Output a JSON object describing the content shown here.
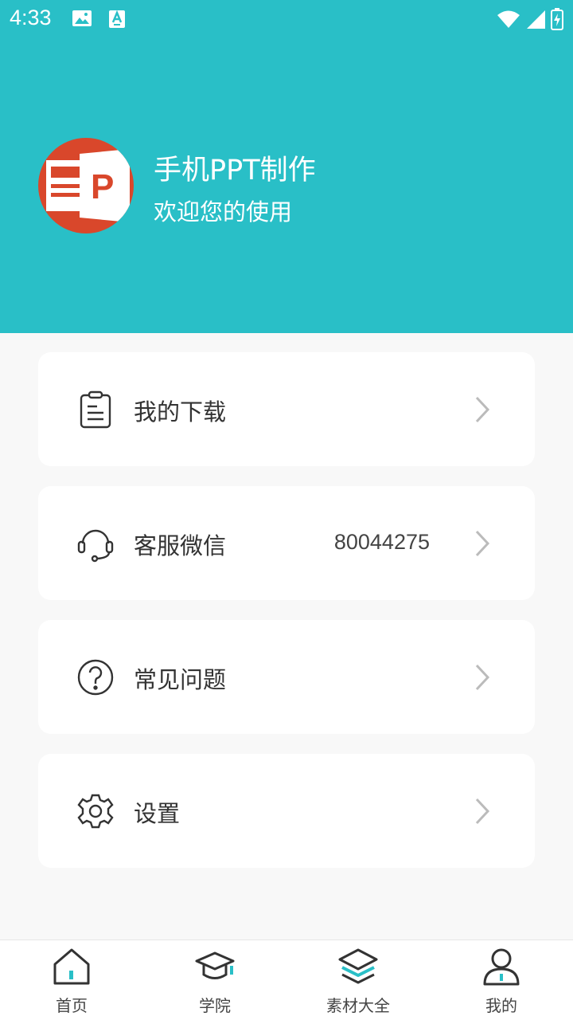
{
  "status_bar": {
    "time": "4:33"
  },
  "profile": {
    "app_name": "手机PPT制作",
    "welcome": "欢迎您的使用"
  },
  "menu": {
    "downloads": {
      "label": "我的下载"
    },
    "wechat": {
      "label": "客服微信",
      "value": "80044275"
    },
    "faq": {
      "label": "常见问题"
    },
    "settings": {
      "label": "设置"
    }
  },
  "bottom_nav": {
    "home": "首页",
    "academy": "学院",
    "materials": "素材大全",
    "mine": "我的"
  },
  "colors": {
    "accent": "#29bfc7",
    "logo": "#d9472b",
    "active_icon": "#29bfc7"
  }
}
